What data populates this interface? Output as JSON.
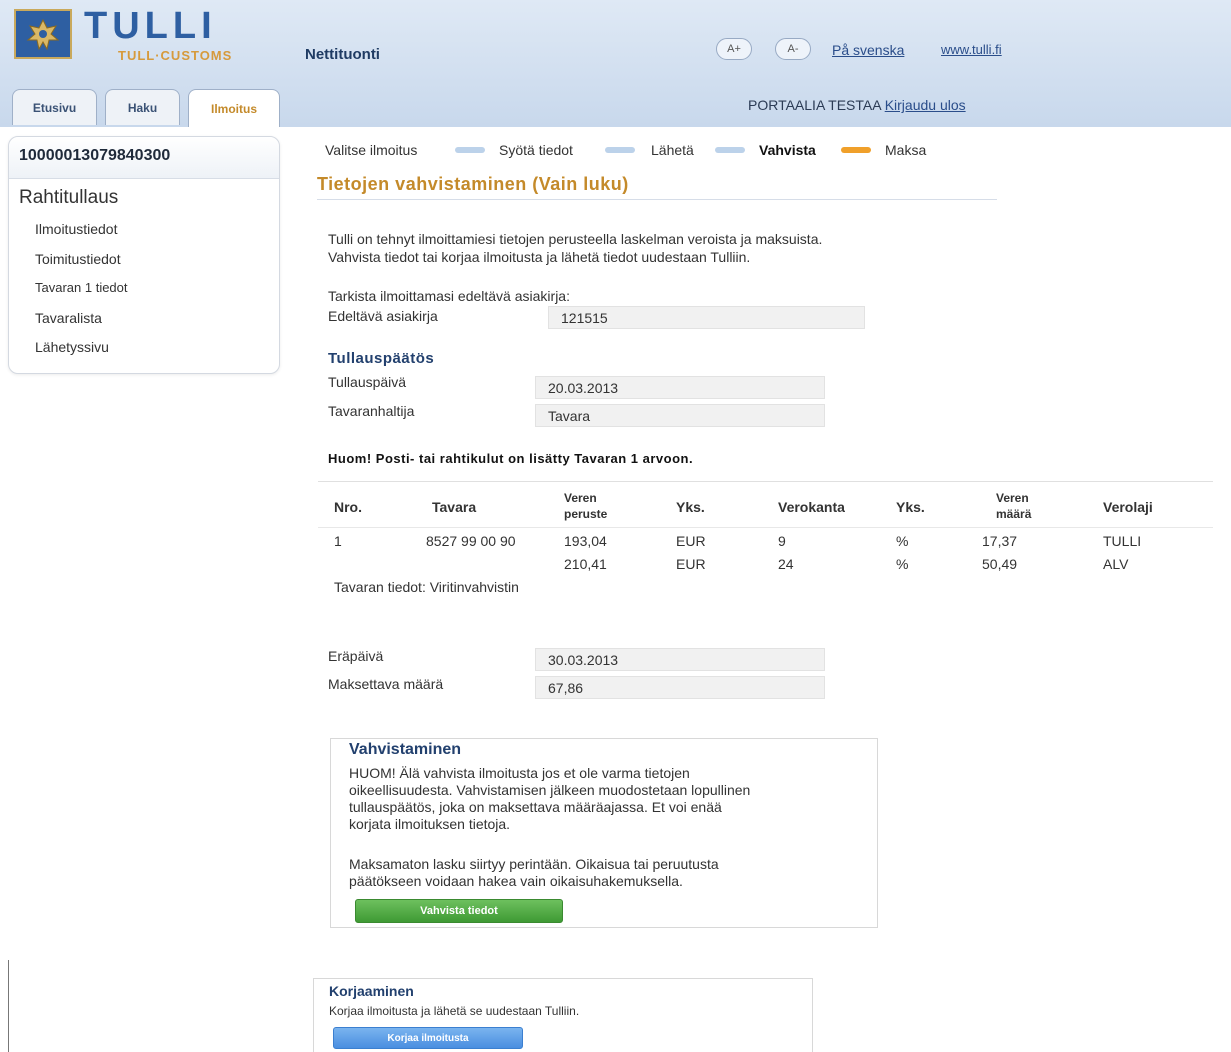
{
  "header": {
    "brand": "TULLI",
    "brand_sub": "TULL·CUSTOMS",
    "service_name": "Nettituonti",
    "font_decrease": "A+",
    "font_increase": "A-",
    "lang_link": "På svenska",
    "site_link": "www.tulli.fi",
    "portal_label": "PORTAALIA TESTAA",
    "logout_label": "Kirjaudu ulos"
  },
  "tabs": [
    {
      "label": "Etusivu"
    },
    {
      "label": "Haku"
    },
    {
      "label": "Ilmoitus"
    }
  ],
  "sidebar": {
    "declaration_id": "10000013079840300",
    "title": "Rahtitullaus",
    "items": [
      {
        "label": "Ilmoitustiedot"
      },
      {
        "label": "Toimitustiedot"
      },
      {
        "label": "Tavaran 1 tiedot"
      },
      {
        "label": "Tavaralista"
      },
      {
        "label": "Lähetyssivu"
      }
    ]
  },
  "steps": [
    {
      "label": "Valitse ilmoitus"
    },
    {
      "label": "Syötä tiedot"
    },
    {
      "label": "Lähetä"
    },
    {
      "label": "Vahvista"
    },
    {
      "label": "Maksa"
    }
  ],
  "page_title": "Tietojen vahvistaminen  (Vain luku)",
  "intro": {
    "line1": "Tulli on tehnyt ilmoittamiesi tietojen perusteella laskelman veroista ja maksuista.",
    "line2": "Vahvista tiedot tai korjaa ilmoitusta ja lähetä tiedot uudestaan Tulliin."
  },
  "prev_doc": {
    "instruction": "Tarkista ilmoittamasi edeltävä asiakirja:",
    "label": "Edeltävä asiakirja",
    "value": "121515"
  },
  "decision": {
    "heading": "Tullauspäätös",
    "date_label": "Tullauspäivä",
    "date_value": "20.03.2013",
    "holder_label": "Tavaranhaltija",
    "holder_value": "Tavara"
  },
  "note": "Huom! Posti- tai rahtikulut on lisätty Tavaran 1 arvoon.",
  "tax_table": {
    "headers": {
      "nro": "Nro.",
      "tavara": "Tavara",
      "peruste": "Veren peruste",
      "yks1": "Yks.",
      "verokanta": "Verokanta",
      "yks2": "Yks.",
      "maara": "Veren määrä",
      "verolaji": "Verolaji"
    },
    "rows": [
      {
        "nro": "1",
        "tavara": "8527 99 00 90",
        "peruste": "193,04",
        "yks1": "EUR",
        "verokanta": "9",
        "yks2": "%",
        "maara": "17,37",
        "verolaji": "TULLI"
      },
      {
        "nro": "",
        "tavara": "",
        "peruste": "210,41",
        "yks1": "EUR",
        "verokanta": "24",
        "yks2": "%",
        "maara": "50,49",
        "verolaji": "ALV"
      }
    ],
    "goods_info": "Tavaran tiedot: Viritinvahvistin"
  },
  "payment": {
    "due_label": "Eräpäivä",
    "due_value": "30.03.2013",
    "amount_label": "Maksettava määrä",
    "amount_value": "67,86"
  },
  "confirm_box": {
    "heading": "Vahvistaminen",
    "p1_l1": "HUOM! Älä vahvista ilmoitusta jos et ole varma tietojen",
    "p1_l2": "oikeellisuudesta. Vahvistamisen jälkeen muodostetaan lopullinen",
    "p1_l3": "tullauspäätös, joka on maksettava määräajassa. Et voi enää",
    "p1_l4": "korjata ilmoituksen tietoja.",
    "p2_l1": "Maksamaton lasku siirtyy perintään. Oikaisua tai peruutusta",
    "p2_l2": "päätökseen voidaan hakea vain oikaisuhakemuksella.",
    "button": "Vahvista tiedot"
  },
  "correct_box": {
    "heading": "Korjaaminen",
    "text": "Korjaa ilmoitusta ja lähetä se uudestaan Tulliin.",
    "button": "Korjaa ilmoitusta"
  }
}
